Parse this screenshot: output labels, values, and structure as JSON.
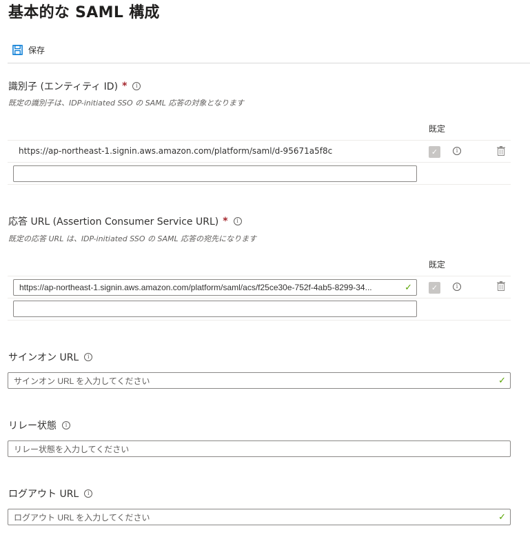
{
  "page": {
    "title": "基本的な SAML 構成"
  },
  "toolbar": {
    "save_label": "保存"
  },
  "identifier": {
    "label": "識別子 (エンティティ ID)",
    "required_mark": "*",
    "hint": "既定の識別子は、IDP-initiated SSO の SAML 応答の対象となります",
    "default_col": "既定",
    "rows": [
      {
        "value": "https://ap-northeast-1.signin.aws.amazon.com/platform/saml/d-95671a5f8c"
      }
    ],
    "new_value": ""
  },
  "reply_url": {
    "label": "応答 URL (Assertion Consumer Service URL)",
    "required_mark": "*",
    "hint": "既定の応答 URL は、IDP-initiated SSO の SAML 応答の宛先になります",
    "default_col": "既定",
    "rows": [
      {
        "value": "https://ap-northeast-1.signin.aws.amazon.com/platform/saml/acs/f25ce30e-752f-4ab5-8299-34..."
      }
    ],
    "new_value": ""
  },
  "sign_on_url": {
    "label": "サインオン URL",
    "placeholder": "サインオン URL を入力してください"
  },
  "relay_state": {
    "label": "リレー状態",
    "placeholder": "リレー状態を入力してください"
  },
  "logout_url": {
    "label": "ログアウト URL",
    "placeholder": "ログアウト URL を入力してください"
  },
  "icons": {
    "info": "i",
    "check": "✓",
    "save": "save-icon",
    "trash": "trash-icon"
  },
  "colors": {
    "required": "#a4262c",
    "valid": "#57a300",
    "save_icon": "#0078d4"
  }
}
